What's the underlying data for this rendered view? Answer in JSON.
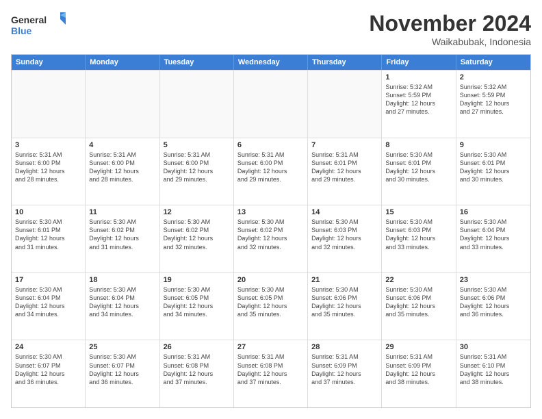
{
  "logo": {
    "line1": "General",
    "line2": "Blue"
  },
  "title": "November 2024",
  "location": "Waikabubak, Indonesia",
  "header_days": [
    "Sunday",
    "Monday",
    "Tuesday",
    "Wednesday",
    "Thursday",
    "Friday",
    "Saturday"
  ],
  "rows": [
    [
      {
        "day": "",
        "info": ""
      },
      {
        "day": "",
        "info": ""
      },
      {
        "day": "",
        "info": ""
      },
      {
        "day": "",
        "info": ""
      },
      {
        "day": "",
        "info": ""
      },
      {
        "day": "1",
        "info": "Sunrise: 5:32 AM\nSunset: 5:59 PM\nDaylight: 12 hours\nand 27 minutes."
      },
      {
        "day": "2",
        "info": "Sunrise: 5:32 AM\nSunset: 5:59 PM\nDaylight: 12 hours\nand 27 minutes."
      }
    ],
    [
      {
        "day": "3",
        "info": "Sunrise: 5:31 AM\nSunset: 6:00 PM\nDaylight: 12 hours\nand 28 minutes."
      },
      {
        "day": "4",
        "info": "Sunrise: 5:31 AM\nSunset: 6:00 PM\nDaylight: 12 hours\nand 28 minutes."
      },
      {
        "day": "5",
        "info": "Sunrise: 5:31 AM\nSunset: 6:00 PM\nDaylight: 12 hours\nand 29 minutes."
      },
      {
        "day": "6",
        "info": "Sunrise: 5:31 AM\nSunset: 6:00 PM\nDaylight: 12 hours\nand 29 minutes."
      },
      {
        "day": "7",
        "info": "Sunrise: 5:31 AM\nSunset: 6:01 PM\nDaylight: 12 hours\nand 29 minutes."
      },
      {
        "day": "8",
        "info": "Sunrise: 5:30 AM\nSunset: 6:01 PM\nDaylight: 12 hours\nand 30 minutes."
      },
      {
        "day": "9",
        "info": "Sunrise: 5:30 AM\nSunset: 6:01 PM\nDaylight: 12 hours\nand 30 minutes."
      }
    ],
    [
      {
        "day": "10",
        "info": "Sunrise: 5:30 AM\nSunset: 6:01 PM\nDaylight: 12 hours\nand 31 minutes."
      },
      {
        "day": "11",
        "info": "Sunrise: 5:30 AM\nSunset: 6:02 PM\nDaylight: 12 hours\nand 31 minutes."
      },
      {
        "day": "12",
        "info": "Sunrise: 5:30 AM\nSunset: 6:02 PM\nDaylight: 12 hours\nand 32 minutes."
      },
      {
        "day": "13",
        "info": "Sunrise: 5:30 AM\nSunset: 6:02 PM\nDaylight: 12 hours\nand 32 minutes."
      },
      {
        "day": "14",
        "info": "Sunrise: 5:30 AM\nSunset: 6:03 PM\nDaylight: 12 hours\nand 32 minutes."
      },
      {
        "day": "15",
        "info": "Sunrise: 5:30 AM\nSunset: 6:03 PM\nDaylight: 12 hours\nand 33 minutes."
      },
      {
        "day": "16",
        "info": "Sunrise: 5:30 AM\nSunset: 6:04 PM\nDaylight: 12 hours\nand 33 minutes."
      }
    ],
    [
      {
        "day": "17",
        "info": "Sunrise: 5:30 AM\nSunset: 6:04 PM\nDaylight: 12 hours\nand 34 minutes."
      },
      {
        "day": "18",
        "info": "Sunrise: 5:30 AM\nSunset: 6:04 PM\nDaylight: 12 hours\nand 34 minutes."
      },
      {
        "day": "19",
        "info": "Sunrise: 5:30 AM\nSunset: 6:05 PM\nDaylight: 12 hours\nand 34 minutes."
      },
      {
        "day": "20",
        "info": "Sunrise: 5:30 AM\nSunset: 6:05 PM\nDaylight: 12 hours\nand 35 minutes."
      },
      {
        "day": "21",
        "info": "Sunrise: 5:30 AM\nSunset: 6:06 PM\nDaylight: 12 hours\nand 35 minutes."
      },
      {
        "day": "22",
        "info": "Sunrise: 5:30 AM\nSunset: 6:06 PM\nDaylight: 12 hours\nand 35 minutes."
      },
      {
        "day": "23",
        "info": "Sunrise: 5:30 AM\nSunset: 6:06 PM\nDaylight: 12 hours\nand 36 minutes."
      }
    ],
    [
      {
        "day": "24",
        "info": "Sunrise: 5:30 AM\nSunset: 6:07 PM\nDaylight: 12 hours\nand 36 minutes."
      },
      {
        "day": "25",
        "info": "Sunrise: 5:30 AM\nSunset: 6:07 PM\nDaylight: 12 hours\nand 36 minutes."
      },
      {
        "day": "26",
        "info": "Sunrise: 5:31 AM\nSunset: 6:08 PM\nDaylight: 12 hours\nand 37 minutes."
      },
      {
        "day": "27",
        "info": "Sunrise: 5:31 AM\nSunset: 6:08 PM\nDaylight: 12 hours\nand 37 minutes."
      },
      {
        "day": "28",
        "info": "Sunrise: 5:31 AM\nSunset: 6:09 PM\nDaylight: 12 hours\nand 37 minutes."
      },
      {
        "day": "29",
        "info": "Sunrise: 5:31 AM\nSunset: 6:09 PM\nDaylight: 12 hours\nand 38 minutes."
      },
      {
        "day": "30",
        "info": "Sunrise: 5:31 AM\nSunset: 6:10 PM\nDaylight: 12 hours\nand 38 minutes."
      }
    ]
  ]
}
